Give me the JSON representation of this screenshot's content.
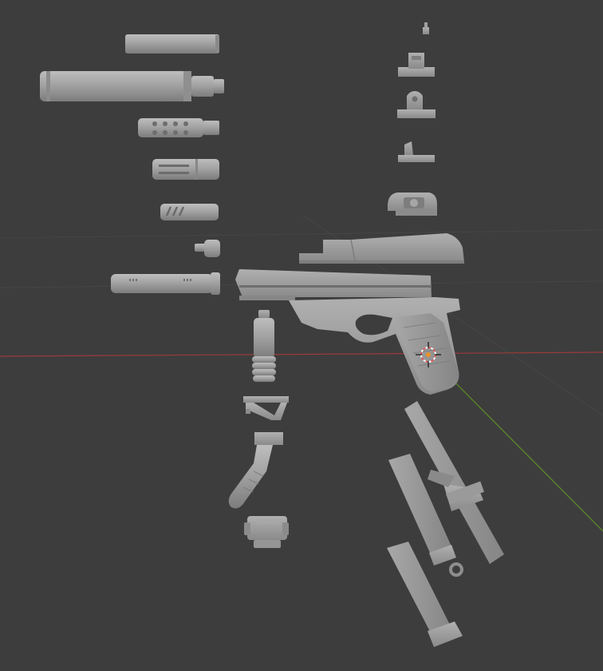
{
  "viewport": {
    "background_color": "#3d3d3d",
    "grid_line_color": "#454545",
    "x_axis_color": "#9b3b3b",
    "y_axis_color": "#5f8f25",
    "model_color": "#9c9c9c",
    "model_shadow_color": "#7a7a7a",
    "model_highlight_color": "#b4b4b4",
    "cursor_outer_color": "#e25c5c",
    "cursor_inner_color": "#ffffff"
  },
  "icons": {
    "cursor": "3d-cursor-icon"
  },
  "parts": [
    "suppressor-short",
    "suppressor-long",
    "muzzle-brake-ported",
    "muzzle-brake-slotted",
    "compensator",
    "thread-protector",
    "barrel-extension",
    "rear-sight-small",
    "rear-sight-block",
    "rear-sight-aperture",
    "front-sight",
    "reflex-sight",
    "slide",
    "pistol-frame",
    "vertical-grip",
    "angled-foregrip",
    "handstop-grip",
    "tactical-light",
    "stock",
    "magazine-extended",
    "magazine-standard"
  ]
}
